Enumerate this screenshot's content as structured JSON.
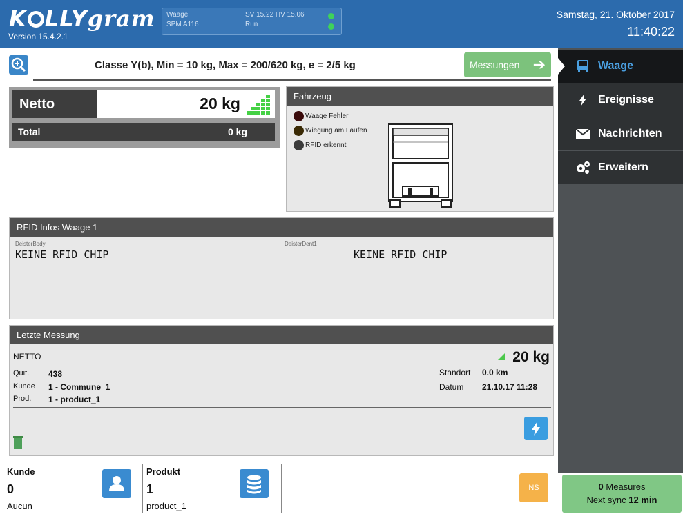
{
  "header": {
    "logo_text": "KOLLYgram",
    "version": "Version 15.4.2.1",
    "scale_name": "Waage",
    "scale_model": "SPM A116",
    "sv_hv": "SV 15.22  HV  15.06",
    "run_state": "Run",
    "date": "Samstag, 21. Oktober 2017",
    "time": "11:40:22"
  },
  "classbar": {
    "text": "Classe Y(b), Min = 10 kg, Max = 200/620 kg, e = 2/5 kg",
    "measurements_button": "Messungen"
  },
  "netto": {
    "label": "Netto",
    "value": "20 kg",
    "total_label": "Total",
    "total_value": "0 kg"
  },
  "fahrzeug": {
    "title": "Fahrzeug",
    "legend": [
      {
        "label": "Waage Fehler",
        "color": "#3a0a0a"
      },
      {
        "label": "Wiegung am Laufen",
        "color": "#3a2a05"
      },
      {
        "label": "RFID erkennt",
        "color": "#3a3a3a"
      }
    ]
  },
  "rfid": {
    "title": "RFID Infos Waage 1",
    "left_caption": "DeisterBody",
    "left_value": "KEINE RFID CHIP",
    "right_caption": "DeisterDent1",
    "right_value": "KEINE RFID CHIP"
  },
  "last": {
    "title": "Letzte Messung",
    "type": "NETTO",
    "value": "20 kg",
    "quit_label": "Quit.",
    "quit_value": "438",
    "kunde_label": "Kunde",
    "kunde_value": "1 - Commune_1",
    "prod_label": "Prod.",
    "prod_value": "1 - product_1",
    "standort_label": "Standort",
    "standort_value": "0.0 km",
    "datum_label": "Datum",
    "datum_value": "21.10.17 11:28"
  },
  "sidebar": {
    "items": [
      {
        "label": "Waage",
        "icon": "bus-icon"
      },
      {
        "label": "Ereignisse",
        "icon": "bolt-icon"
      },
      {
        "label": "Nachrichten",
        "icon": "envelope-icon"
      },
      {
        "label": "Erweitern",
        "icon": "cogs-icon"
      }
    ]
  },
  "bottom": {
    "kunde_label": "Kunde",
    "kunde_num": "0",
    "kunde_name": "Aucun",
    "produkt_label": "Produkt",
    "produkt_num": "1",
    "produkt_name": "product_1",
    "ns_label": "NS",
    "sync_count": "0",
    "sync_measures": "Measures",
    "sync_next": "Next sync",
    "sync_time": "12 min"
  },
  "colors": {
    "header_blue": "#2c6bad",
    "accent_green": "#7cc27c",
    "sidebar_active_text": "#4a9fe0",
    "ns_orange": "#f5b249"
  }
}
